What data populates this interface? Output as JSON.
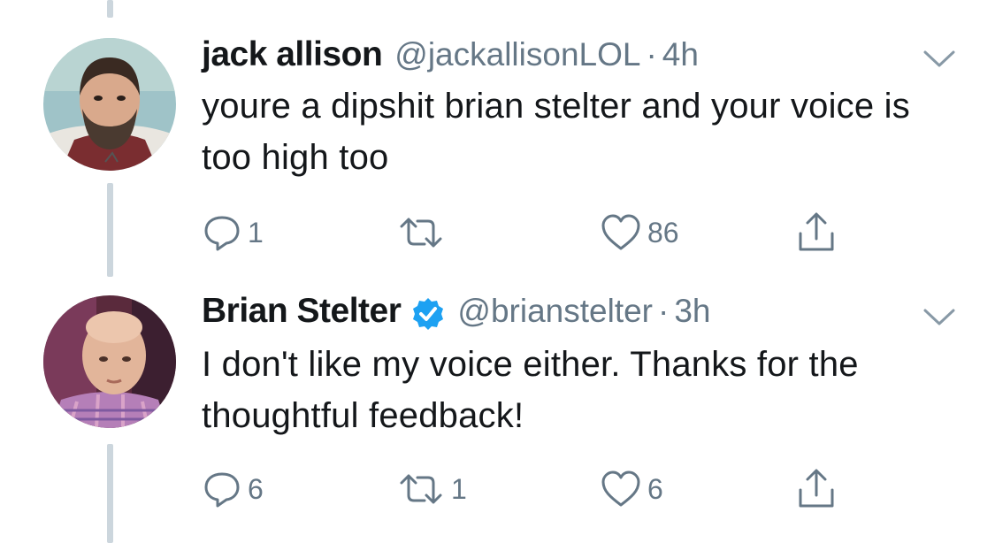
{
  "tweets": [
    {
      "name": "jack allison",
      "handle": "@jackallisonLOL",
      "separator": "·",
      "time": "4h",
      "verified": false,
      "text": "youre a dipshit brian stelter and your voice is too high too",
      "replies": "1",
      "retweets": "",
      "likes": "86",
      "avatar_icon": "avatar-photo-jack-allison"
    },
    {
      "name": "Brian Stelter",
      "handle": "@brianstelter",
      "separator": "·",
      "time": "3h",
      "verified": true,
      "text": "I don't like my voice either. Thanks for the thoughtful feedback!",
      "replies": "6",
      "retweets": "1",
      "likes": "6",
      "avatar_icon": "avatar-photo-brian-stelter"
    }
  ],
  "icons": {
    "reply": "reply-icon",
    "retweet": "retweet-icon",
    "like": "heart-icon",
    "share": "share-icon",
    "more": "chevron-down-icon",
    "verified": "verified-badge-icon"
  },
  "colors": {
    "text": "#14171a",
    "secondary": "#657786",
    "verified": "#1da1f2",
    "thread_line": "#ccd6dd"
  }
}
